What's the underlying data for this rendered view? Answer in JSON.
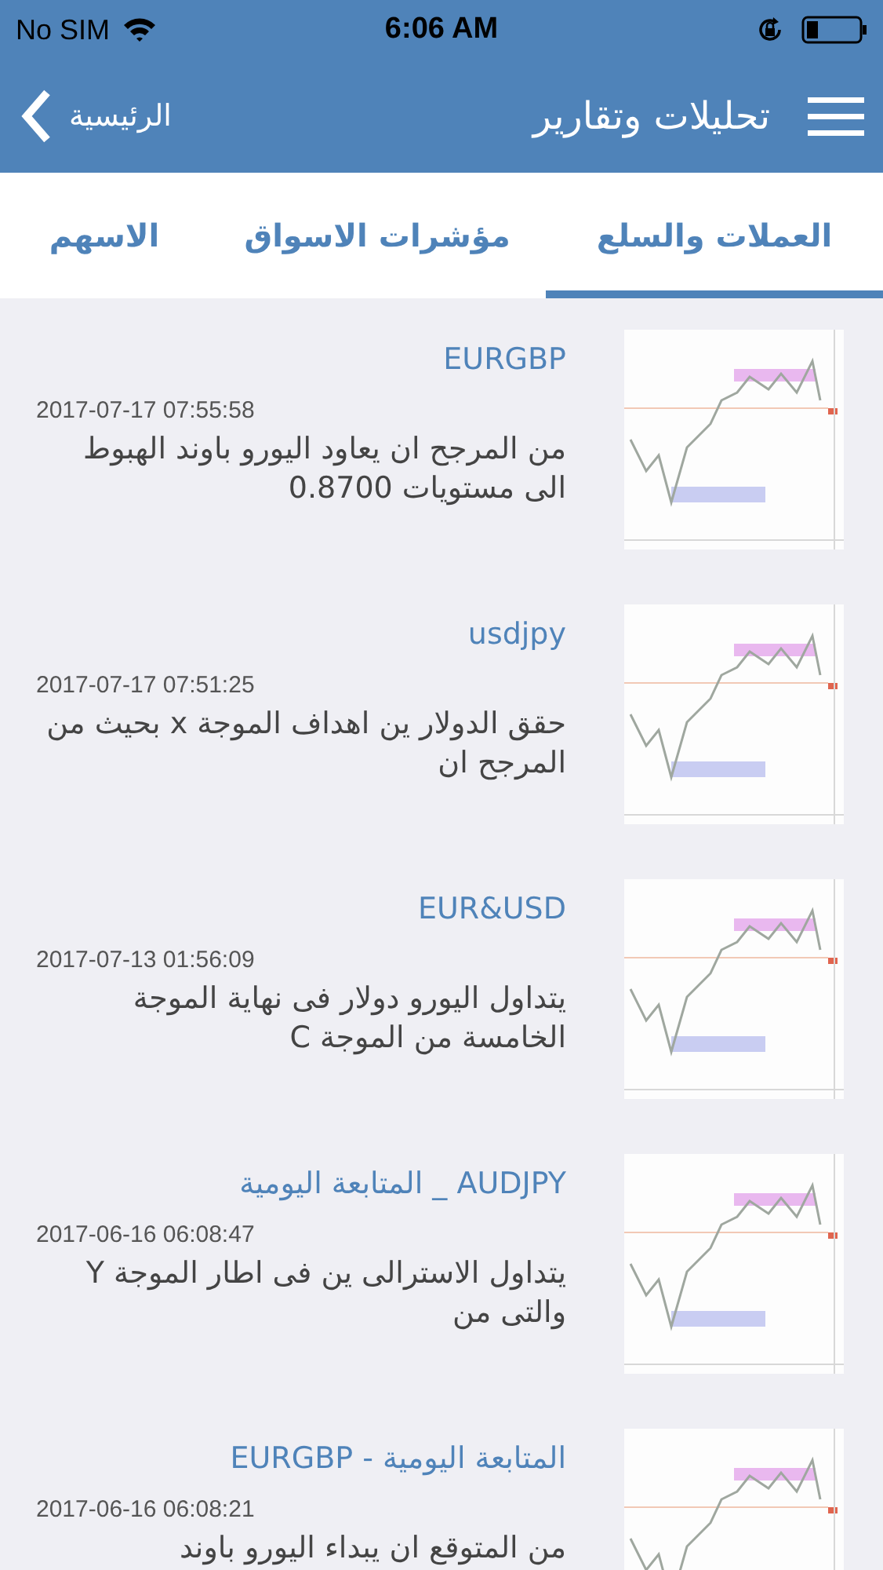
{
  "status_bar": {
    "carrier": "No SIM",
    "time": "6:06 AM"
  },
  "nav": {
    "title": "تحليلات وتقارير",
    "back": "الرئيسية"
  },
  "tabs": [
    {
      "label": "العملات والسلع",
      "selected": true
    },
    {
      "label": "مؤشرات الاسواق",
      "selected": false
    },
    {
      "label": "الاسهم",
      "selected": false
    }
  ],
  "reports": [
    {
      "title": "EURGBP",
      "date": "2017-07-17 07:55:58",
      "summary": "من المرجح ان يعاود اليورو باوند الهبوط الى مستويات 0.8700"
    },
    {
      "title": "usdjpy",
      "date": "2017-07-17 07:51:25",
      "summary": "حقق الدولار ين اهداف الموجة x بحيث من المرجح ان"
    },
    {
      "title": "EUR&USD",
      "date": "2017-07-13 01:56:09",
      "summary": "يتداول اليورو دولار فى نهاية الموجة الخامسة من الموجة C"
    },
    {
      "title": "AUDJPY _ المتابعة اليومية",
      "date": "2017-06-16 06:08:47",
      "summary": "يتداول الاسترالى ين فى اطار الموجة Y والتى من"
    },
    {
      "title": "المتابعة اليومية - EURGBP",
      "date": "2017-06-16 06:08:21",
      "summary": "من المتوقع ان يبداء اليورو باوند"
    }
  ]
}
